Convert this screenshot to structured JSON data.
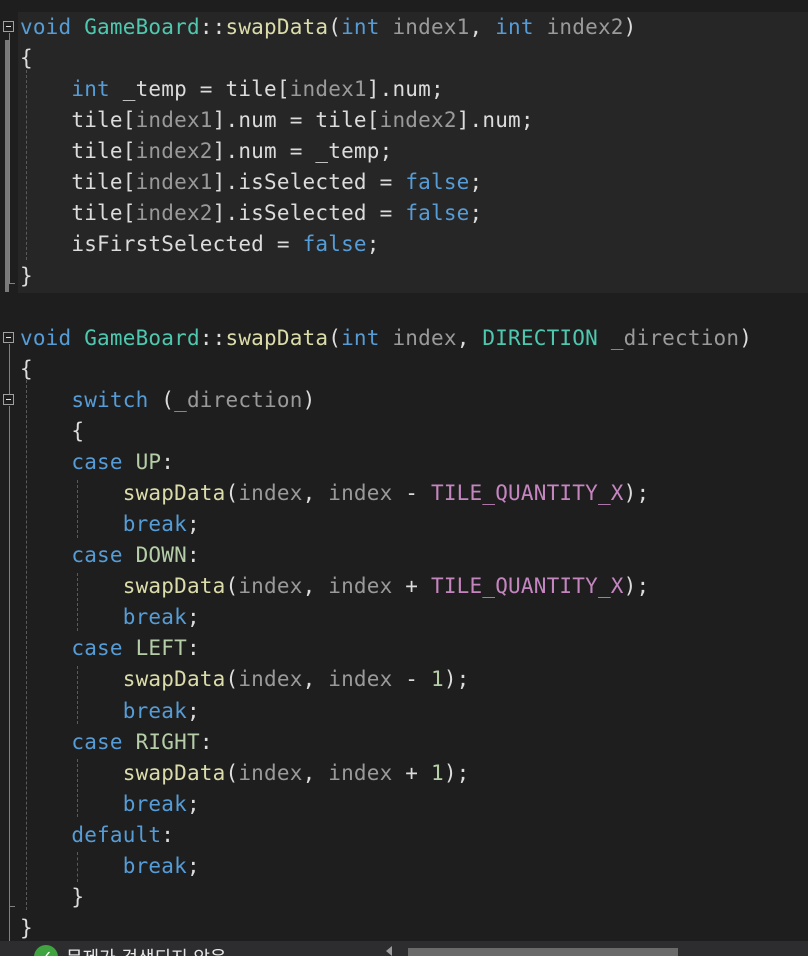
{
  "colors": {
    "background": "#1e1e1e",
    "keyword": "#569cd6",
    "type": "#4ec9b0",
    "function": "#dcdcaa",
    "parameter": "#9a9a9a",
    "macro": "#c586c0",
    "enum_member": "#b5cea8",
    "number": "#b5cea8",
    "plain": "#dcdcdc"
  },
  "code": {
    "lines": [
      [
        [
          "void",
          "keyword"
        ],
        [
          " ",
          "plain"
        ],
        [
          "GameBoard",
          "type"
        ],
        [
          "::",
          "plain"
        ],
        [
          "swapData",
          "function"
        ],
        [
          "(",
          "plain"
        ],
        [
          "int",
          "keyword"
        ],
        [
          " ",
          "plain"
        ],
        [
          "index1",
          "parameter"
        ],
        [
          ", ",
          "plain"
        ],
        [
          "int",
          "keyword"
        ],
        [
          " ",
          "plain"
        ],
        [
          "index2",
          "parameter"
        ],
        [
          ")",
          "plain"
        ]
      ],
      [
        [
          "{",
          "plain"
        ]
      ],
      [
        [
          "    ",
          "plain"
        ],
        [
          "int",
          "keyword"
        ],
        [
          " _temp = tile",
          "plain"
        ],
        [
          "[",
          "plain"
        ],
        [
          "index1",
          "parameter"
        ],
        [
          "].num;",
          "plain"
        ]
      ],
      [
        [
          "    tile[",
          "plain"
        ],
        [
          "index1",
          "parameter"
        ],
        [
          "].num = tile[",
          "plain"
        ],
        [
          "index2",
          "parameter"
        ],
        [
          "].num;",
          "plain"
        ]
      ],
      [
        [
          "    tile[",
          "plain"
        ],
        [
          "index2",
          "parameter"
        ],
        [
          "].num = _temp;",
          "plain"
        ]
      ],
      [
        [
          "    tile[",
          "plain"
        ],
        [
          "index1",
          "parameter"
        ],
        [
          "].isSelected = ",
          "plain"
        ],
        [
          "false",
          "keyword"
        ],
        [
          ";",
          "plain"
        ]
      ],
      [
        [
          "    tile[",
          "plain"
        ],
        [
          "index2",
          "parameter"
        ],
        [
          "].isSelected = ",
          "plain"
        ],
        [
          "false",
          "keyword"
        ],
        [
          ";",
          "plain"
        ]
      ],
      [
        [
          "    isFirstSelected = ",
          "plain"
        ],
        [
          "false",
          "keyword"
        ],
        [
          ";",
          "plain"
        ]
      ],
      [
        [
          "}",
          "plain"
        ]
      ],
      [
        [
          "",
          "plain"
        ]
      ],
      [
        [
          "void",
          "keyword"
        ],
        [
          " ",
          "plain"
        ],
        [
          "GameBoard",
          "type"
        ],
        [
          "::",
          "plain"
        ],
        [
          "swapData",
          "function"
        ],
        [
          "(",
          "plain"
        ],
        [
          "int",
          "keyword"
        ],
        [
          " ",
          "plain"
        ],
        [
          "index",
          "parameter"
        ],
        [
          ", ",
          "plain"
        ],
        [
          "DIRECTION",
          "type"
        ],
        [
          " ",
          "plain"
        ],
        [
          "_direction",
          "parameter"
        ],
        [
          ")",
          "plain"
        ]
      ],
      [
        [
          "{",
          "plain"
        ]
      ],
      [
        [
          "    ",
          "plain"
        ],
        [
          "switch",
          "keyword"
        ],
        [
          " (",
          "plain"
        ],
        [
          "_direction",
          "parameter"
        ],
        [
          ")",
          "plain"
        ]
      ],
      [
        [
          "    {",
          "plain"
        ]
      ],
      [
        [
          "    ",
          "plain"
        ],
        [
          "case",
          "keyword"
        ],
        [
          " ",
          "plain"
        ],
        [
          "UP",
          "enum"
        ],
        [
          ":",
          "plain"
        ]
      ],
      [
        [
          "        ",
          "plain"
        ],
        [
          "swapData",
          "function"
        ],
        [
          "(",
          "plain"
        ],
        [
          "index",
          "parameter"
        ],
        [
          ", ",
          "plain"
        ],
        [
          "index",
          "parameter"
        ],
        [
          " - ",
          "plain"
        ],
        [
          "TILE_QUANTITY_X",
          "macro"
        ],
        [
          ");",
          "plain"
        ]
      ],
      [
        [
          "        ",
          "plain"
        ],
        [
          "break",
          "keyword"
        ],
        [
          ";",
          "plain"
        ]
      ],
      [
        [
          "    ",
          "plain"
        ],
        [
          "case",
          "keyword"
        ],
        [
          " ",
          "plain"
        ],
        [
          "DOWN",
          "enum"
        ],
        [
          ":",
          "plain"
        ]
      ],
      [
        [
          "        ",
          "plain"
        ],
        [
          "swapData",
          "function"
        ],
        [
          "(",
          "plain"
        ],
        [
          "index",
          "parameter"
        ],
        [
          ", ",
          "plain"
        ],
        [
          "index",
          "parameter"
        ],
        [
          " + ",
          "plain"
        ],
        [
          "TILE_QUANTITY_X",
          "macro"
        ],
        [
          ");",
          "plain"
        ]
      ],
      [
        [
          "        ",
          "plain"
        ],
        [
          "break",
          "keyword"
        ],
        [
          ";",
          "plain"
        ]
      ],
      [
        [
          "    ",
          "plain"
        ],
        [
          "case",
          "keyword"
        ],
        [
          " ",
          "plain"
        ],
        [
          "LEFT",
          "enum"
        ],
        [
          ":",
          "plain"
        ]
      ],
      [
        [
          "        ",
          "plain"
        ],
        [
          "swapData",
          "function"
        ],
        [
          "(",
          "plain"
        ],
        [
          "index",
          "parameter"
        ],
        [
          ", ",
          "plain"
        ],
        [
          "index",
          "parameter"
        ],
        [
          " - ",
          "plain"
        ],
        [
          "1",
          "number"
        ],
        [
          ");",
          "plain"
        ]
      ],
      [
        [
          "        ",
          "plain"
        ],
        [
          "break",
          "keyword"
        ],
        [
          ";",
          "plain"
        ]
      ],
      [
        [
          "    ",
          "plain"
        ],
        [
          "case",
          "keyword"
        ],
        [
          " ",
          "plain"
        ],
        [
          "RIGHT",
          "enum"
        ],
        [
          ":",
          "plain"
        ]
      ],
      [
        [
          "        ",
          "plain"
        ],
        [
          "swapData",
          "function"
        ],
        [
          "(",
          "plain"
        ],
        [
          "index",
          "parameter"
        ],
        [
          ", ",
          "plain"
        ],
        [
          "index",
          "parameter"
        ],
        [
          " + ",
          "plain"
        ],
        [
          "1",
          "number"
        ],
        [
          ");",
          "plain"
        ]
      ],
      [
        [
          "        ",
          "plain"
        ],
        [
          "break",
          "keyword"
        ],
        [
          ";",
          "plain"
        ]
      ],
      [
        [
          "    ",
          "plain"
        ],
        [
          "default",
          "keyword"
        ],
        [
          ":",
          "plain"
        ]
      ],
      [
        [
          "        ",
          "plain"
        ],
        [
          "break",
          "keyword"
        ],
        [
          ";",
          "plain"
        ]
      ],
      [
        [
          "    }",
          "plain"
        ]
      ],
      [
        [
          "}",
          "plain"
        ]
      ]
    ]
  },
  "status": {
    "icon": "check-circle-icon",
    "message": "문제가 검색되지 않음"
  }
}
